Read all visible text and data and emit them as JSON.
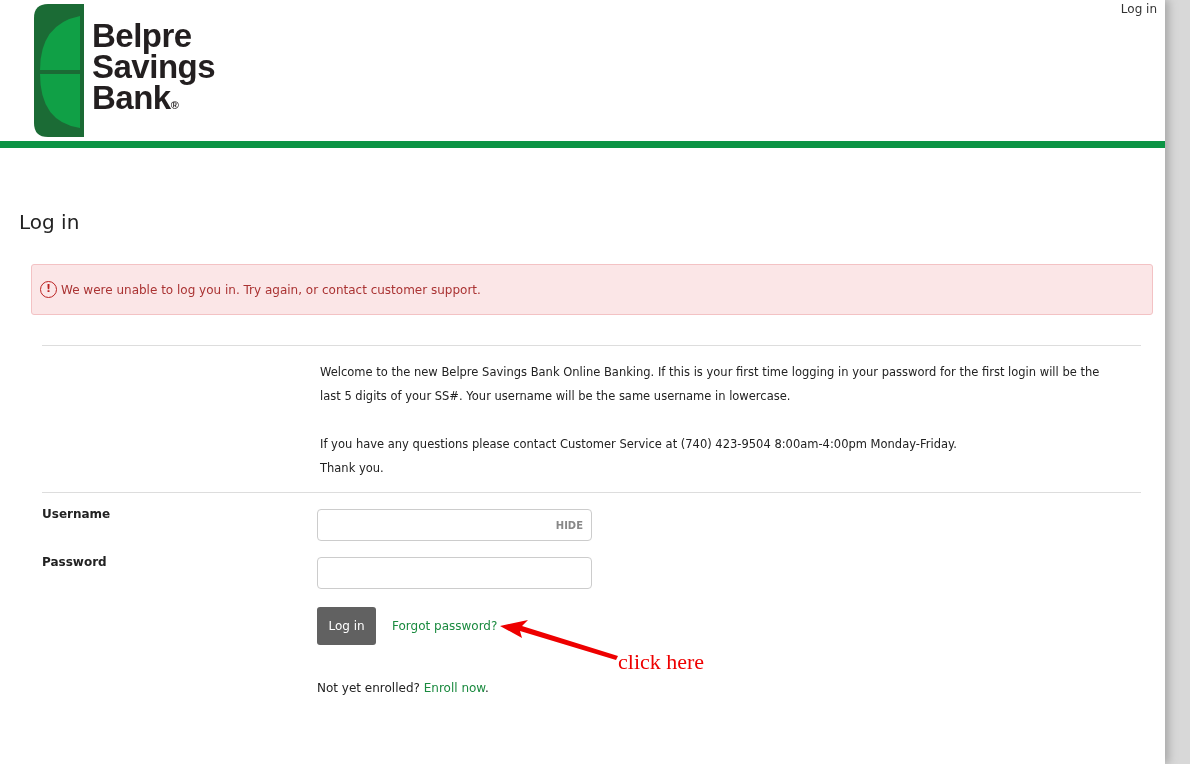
{
  "header": {
    "logo_lines": [
      "Belpre",
      "Savings",
      "Bank"
    ],
    "logo_mark": "®",
    "login_link": "Log in"
  },
  "page_title": "Log in",
  "alert": {
    "icon_char": "!",
    "message": "We were unable to log you in. Try again, or contact customer support."
  },
  "welcome": [
    "Welcome to the new Belpre Savings Bank Online Banking. If this is your first time logging in your password for the first login will be the last 5 digits of your SS#. Your username will be the same username in lowercase.",
    "If you have any questions please contact Customer Service at (740) 423-9504 8:00am-4:00pm Monday-Friday.",
    "Thank you."
  ],
  "fields": [
    {
      "label": "Username",
      "toggle": "HIDE"
    },
    {
      "label": "Password"
    }
  ],
  "login_button": "Log in",
  "forgot_link": "Forgot password?",
  "enroll": {
    "text": "Not yet enrolled?",
    "link": "Enroll now",
    "after": "."
  },
  "annotation": {
    "text": "click here"
  }
}
